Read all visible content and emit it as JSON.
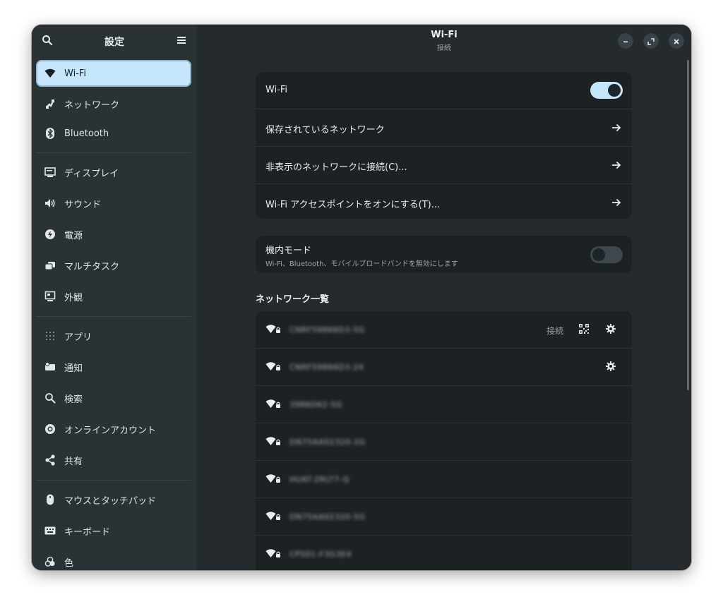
{
  "sidebar": {
    "title": "設定",
    "items": [
      {
        "label": "Wi-Fi",
        "icon": "wifi-icon"
      },
      {
        "label": "ネットワーク",
        "icon": "network-icon"
      },
      {
        "label": "Bluetooth",
        "icon": "bluetooth-icon"
      },
      {
        "label": "ディスプレイ",
        "icon": "display-icon"
      },
      {
        "label": "サウンド",
        "icon": "sound-icon"
      },
      {
        "label": "電源",
        "icon": "power-icon"
      },
      {
        "label": "マルチタスク",
        "icon": "multitask-icon"
      },
      {
        "label": "外観",
        "icon": "appearance-icon"
      },
      {
        "label": "アプリ",
        "icon": "apps-icon"
      },
      {
        "label": "通知",
        "icon": "notifications-icon"
      },
      {
        "label": "検索",
        "icon": "search-icon"
      },
      {
        "label": "オンラインアカウント",
        "icon": "online-accounts-icon"
      },
      {
        "label": "共有",
        "icon": "share-icon"
      },
      {
        "label": "マウスとタッチパッド",
        "icon": "mouse-icon"
      },
      {
        "label": "キーボード",
        "icon": "keyboard-icon"
      },
      {
        "label": "色",
        "icon": "color-icon"
      }
    ]
  },
  "header": {
    "title": "Wi-Fi",
    "subtitle": "接続"
  },
  "wifi_card": {
    "wifi_label": "Wi-Fi",
    "wifi_enabled": true,
    "saved_networks": "保存されているネットワーク",
    "hidden_network": "非表示のネットワークに接続(C)...",
    "hotspot": "Wi-Fi アクセスポイントをオンにする(T)..."
  },
  "airplane": {
    "label": "機内モード",
    "description": "Wi-Fi、Bluetooth、モバイルブロードバンドを無効にします",
    "enabled": false
  },
  "network_list": {
    "title": "ネットワーク一覧",
    "connected_label": "接続",
    "networks": [
      {
        "name": "CNRF59866D3-5G"
      },
      {
        "name": "CNRF59866D3-24"
      },
      {
        "name": "3986D62-5G"
      },
      {
        "name": "DN75AA02320-2G"
      },
      {
        "name": "HUAT-2RLT7-Q"
      },
      {
        "name": "DN75AA02320-5G"
      },
      {
        "name": "CPS01-F3G3E4"
      }
    ]
  },
  "colors": {
    "accent": "#c6e7fb",
    "sidebar_bg": "#2a3236",
    "main_bg": "#242a2d",
    "card_bg": "#1c2124"
  }
}
